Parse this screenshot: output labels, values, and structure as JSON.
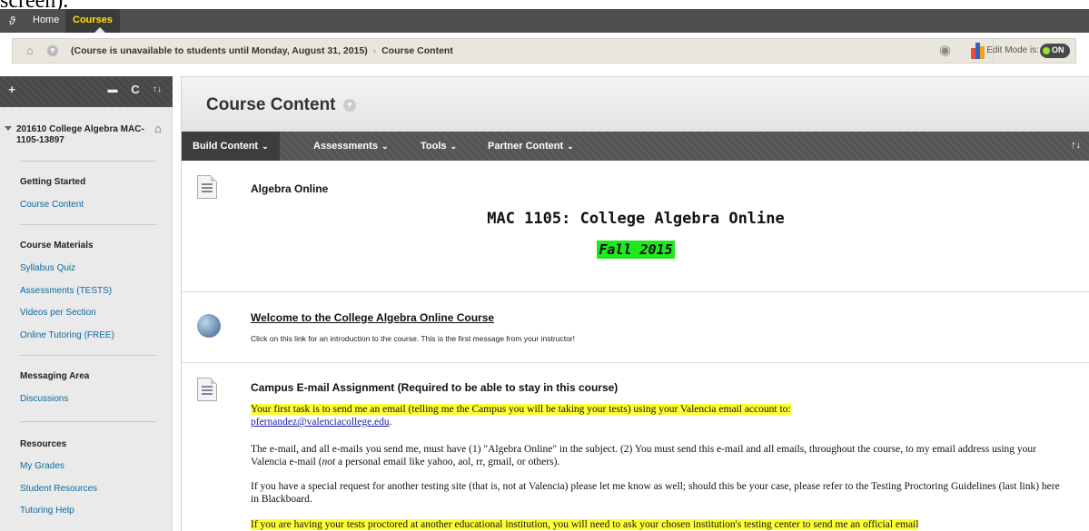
{
  "cut_text": "screen).",
  "topnav": {
    "home": "Home",
    "courses": "Courses"
  },
  "breadcrumb": {
    "notice": "(Course is unavailable to students until Monday, August 31, 2015)",
    "separator": "›",
    "current": "Course Content",
    "edit_mode_label": "Edit Mode is:",
    "edit_mode_value": "ON"
  },
  "sidebar": {
    "tools": {
      "add": "+",
      "refresh": "C",
      "sort": "↑↓"
    },
    "course_name": "201610 College Algebra MAC-1105-13897",
    "sections": [
      {
        "heading": "Getting Started",
        "links": [
          "Course Content"
        ]
      },
      {
        "heading": "Course Materials",
        "links": [
          "Syllabus Quiz",
          "Assessments (TESTS)",
          "Videos per Section",
          "Online Tutoring (FREE)"
        ]
      },
      {
        "heading": "Messaging Area",
        "links": [
          "Discussions"
        ]
      },
      {
        "heading": "Resources",
        "links": [
          "My Grades",
          "Student Resources",
          "Tutoring Help"
        ]
      }
    ]
  },
  "main": {
    "title": "Course Content",
    "actions": [
      "Build Content",
      "Assessments",
      "Tools",
      "Partner Content"
    ],
    "sort_icon": "↑↓",
    "item1": {
      "title": "Algebra Online",
      "heading": "MAC 1105: College Algebra Online",
      "term": "Fall 2015"
    },
    "item2": {
      "title": "Welcome to the College Algebra Online Course",
      "desc": "Click on this link for an introduction to the course. This is the first message from your instructor!"
    },
    "item3": {
      "title": "Campus E-mail Assignment (Required to be able to stay in this course)",
      "p1_highlight": "Your first task is to send me an email (telling me the Campus you will be taking your tests) using your Valencia email account to:",
      "email": "pfernandez@valenciacollege.edu",
      "p2_a": "The e-mail, and all e-mails you send me, must have (1) \"Algebra Online\" in the subject. (2) You must send this e-mail and all emails, throughout the course,  to my email address using your Valencia e-mail (",
      "p2_not": "not",
      "p2_b": " a personal email like yahoo, aol, rr, gmail, or others).",
      "p3": "If you have a special request for another testing site (that is, not at Valencia) please let me know as well; should this be your case, please refer to the Testing Proctoring Guidelines (last link) here in Blackboard.",
      "p4_highlight": "If you are having your tests proctored at another educational institution, you will need to ask your chosen institution's testing center to send me an official email"
    }
  }
}
